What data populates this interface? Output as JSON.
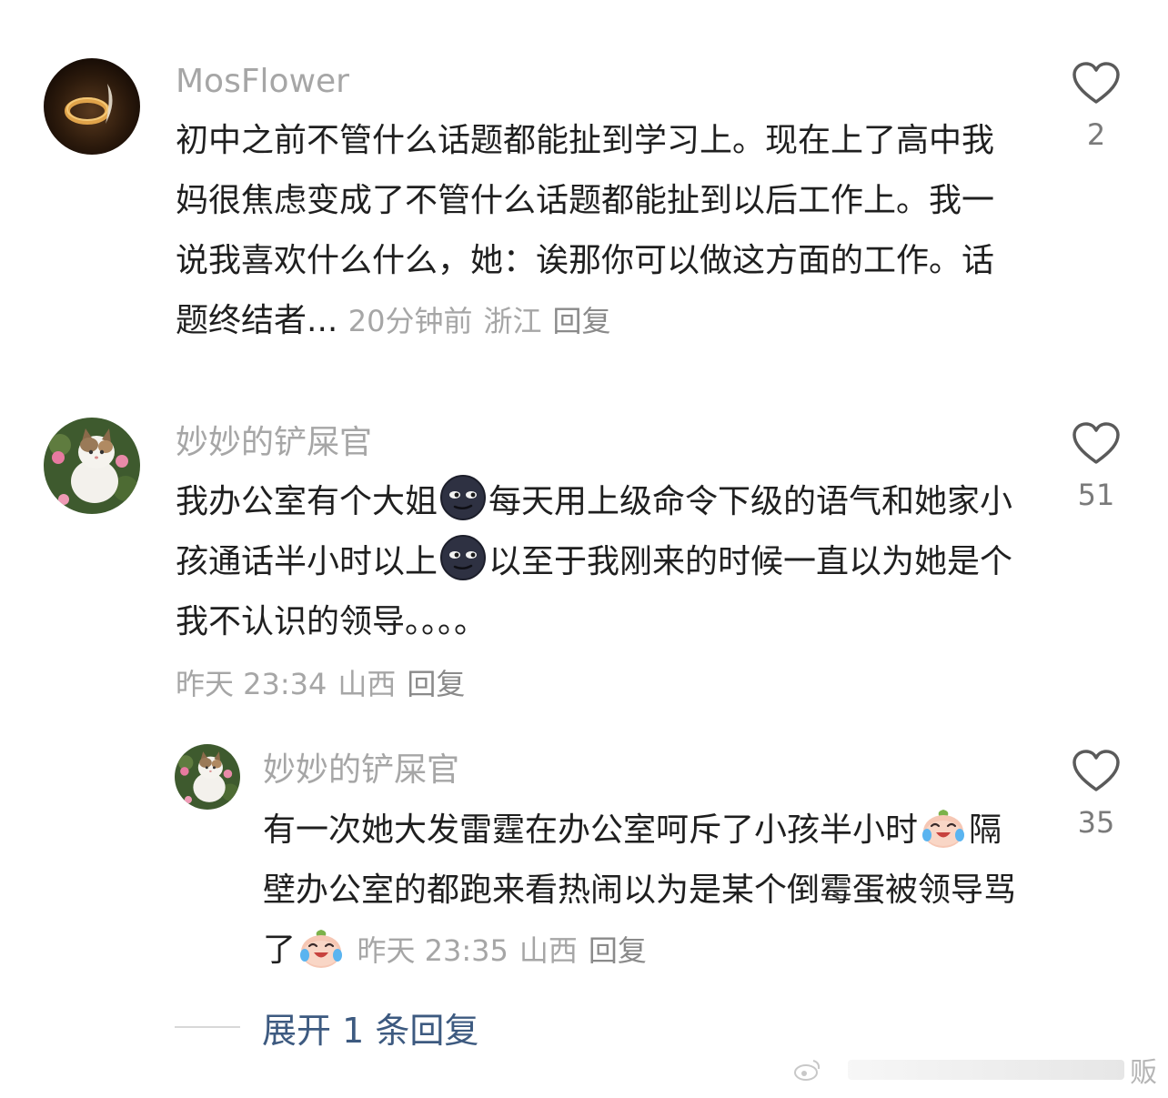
{
  "comments": [
    {
      "username": "MosFlower",
      "text": "初中之前不管什么话题都能扯到学习上。现在上了高中我妈很焦虑变成了不管什么话题都能扯到以后工作上。我一说我喜欢什么什么，她：诶那你可以做这方面的工作。话题终结者...",
      "time": "20分钟前",
      "location": "浙江",
      "reply_label": "回复",
      "likes": "2",
      "avatar_icon": "ring-feather-avatar"
    },
    {
      "username": "妙妙的铲屎官",
      "text_parts": [
        "我办公室有个大姐",
        "每天用上级命令下级的语气和她家小孩通话半小时以上",
        "以至于我刚来的时候一直以为她是个我不认识的领导。。。。"
      ],
      "emoji_1": "smirking-dark-face-emoji",
      "emoji_2": "smirking-dark-face-emoji",
      "time": "昨天 23:34",
      "location": "山西",
      "reply_label": "回复",
      "likes": "51",
      "avatar_icon": "cat-in-flowers-avatar"
    },
    {
      "username": "妙妙的铲屎官",
      "text_parts": [
        "有一次她大发雷霆在办公室呵斥了小孩半小时",
        "隔壁办公室的都跑来看热闹以为是某个倒霉蛋被领导骂了"
      ],
      "emoji_1": "crying-laughing-peach-emoji",
      "emoji_2": "crying-laughing-peach-emoji",
      "time": "昨天 23:35",
      "location": "山西",
      "reply_label": "回复",
      "likes": "35",
      "avatar_icon": "cat-in-flowers-avatar"
    }
  ],
  "expand_replies": "展开 1 条回复",
  "watermark": "贩"
}
